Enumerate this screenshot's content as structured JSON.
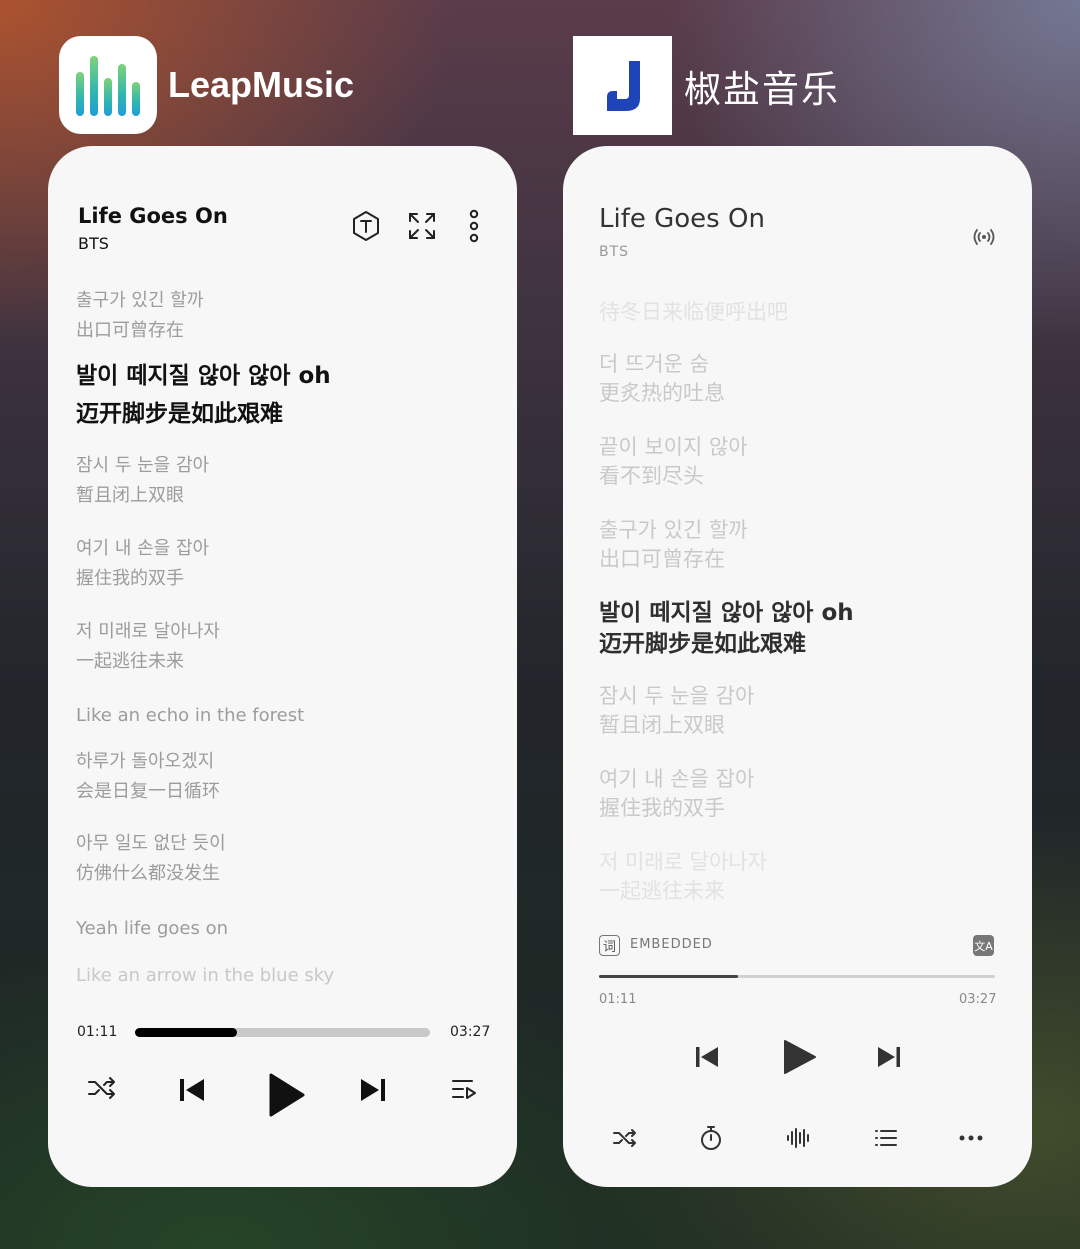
{
  "leapmusic": {
    "app_name": "LeapMusic",
    "song_title": "Life Goes On",
    "artist": "BTS",
    "lyrics": [
      {
        "line1": "출구가 있긴 할까",
        "line2": "出口可曾存在",
        "current": false
      },
      {
        "line1": "발이 떼지질 않아 않아 oh",
        "line2": "迈开脚步是如此艰难",
        "current": true
      },
      {
        "line1": "잠시 두 눈을 감아",
        "line2": "暂且闭上双眼",
        "current": false
      },
      {
        "line1": "여기 내 손을 잡아",
        "line2": "握住我的双手",
        "current": false
      },
      {
        "line1": "저 미래로 달아나자",
        "line2": "一起逃往未来",
        "current": false
      },
      {
        "line1": "Like an echo in the forest",
        "line2": "",
        "current": false
      },
      {
        "line1": "하루가 돌아오겠지",
        "line2": "会是日复一日循环",
        "current": false
      },
      {
        "line1": "아무 일도 없단 듯이",
        "line2": "仿佛什么都没发生",
        "current": false
      },
      {
        "line1": "Yeah life goes on",
        "line2": "",
        "current": false
      },
      {
        "line1": "Like an arrow in the blue sky",
        "line2": "",
        "current": false
      }
    ],
    "elapsed": "01:11",
    "duration": "03:27",
    "progress": 0.345
  },
  "jiaoyan": {
    "app_name": "椒盐音乐",
    "song_title": "Life Goes On",
    "artist": "BTS",
    "lyrics": [
      {
        "line1": "待冬日来临便呼出吧",
        "line2": "",
        "current": false
      },
      {
        "line1": "더 뜨거운 숨",
        "line2": "更炙热的吐息",
        "current": false
      },
      {
        "line1": "끝이 보이지 않아",
        "line2": "看不到尽头",
        "current": false
      },
      {
        "line1": "출구가 있긴 할까",
        "line2": "出口可曾存在",
        "current": false
      },
      {
        "line1": "발이 떼지질 않아 않아 oh",
        "line2": "迈开脚步是如此艰难",
        "current": true
      },
      {
        "line1": "잠시 두 눈을 감아",
        "line2": "暂且闭上双眼",
        "current": false
      },
      {
        "line1": "여기 내 손을 잡아",
        "line2": "握住我的双手",
        "current": false
      },
      {
        "line1": "저 미래로 달아나자",
        "line2": "一起逃往未来",
        "current": false
      }
    ],
    "lyrics_source_icon": "词",
    "lyrics_source": "EMBEDDED",
    "translate_icon": "文A",
    "elapsed": "01:11",
    "duration": "03:27",
    "progress": 0.35
  },
  "colors": {
    "leap_gradient": [
      "#7fd27a",
      "#2fb6b0",
      "#1f9fd6"
    ],
    "jiaoyan_logo": "#1f44b8"
  }
}
